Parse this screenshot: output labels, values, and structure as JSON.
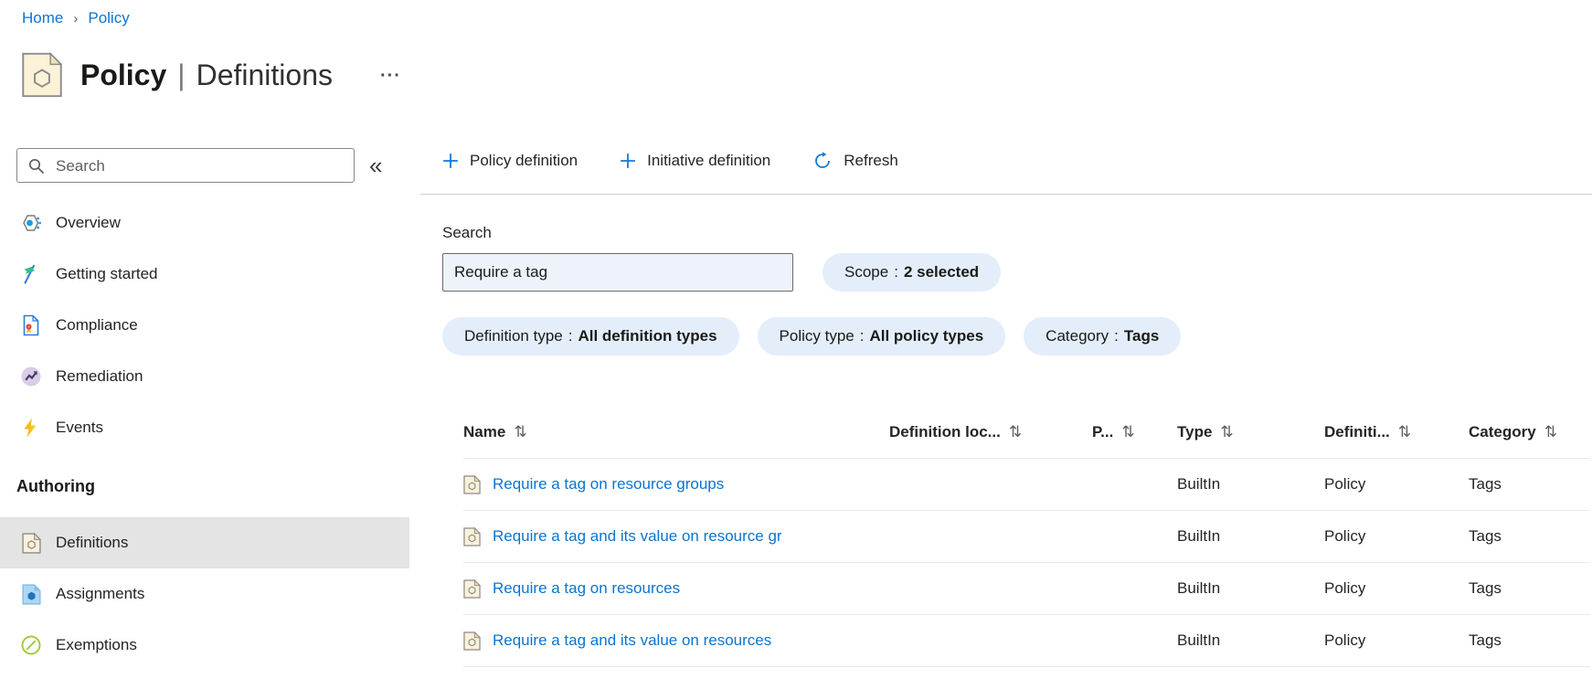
{
  "breadcrumb": {
    "separator": "›",
    "items": [
      {
        "label": "Home"
      },
      {
        "label": "Policy"
      }
    ]
  },
  "header": {
    "title_primary": "Policy",
    "title_separator": "|",
    "title_secondary": "Definitions",
    "more_glyph": "···"
  },
  "sidebar": {
    "search_placeholder": "Search",
    "collapse_glyph": "«",
    "items": [
      {
        "label": "Overview",
        "icon": "overview-icon"
      },
      {
        "label": "Getting started",
        "icon": "getting-started-icon"
      },
      {
        "label": "Compliance",
        "icon": "compliance-icon"
      },
      {
        "label": "Remediation",
        "icon": "remediation-icon"
      },
      {
        "label": "Events",
        "icon": "events-icon"
      }
    ],
    "section_label": "Authoring",
    "authoring_items": [
      {
        "label": "Definitions",
        "icon": "definitions-icon",
        "selected": true
      },
      {
        "label": "Assignments",
        "icon": "assignments-icon",
        "selected": false
      },
      {
        "label": "Exemptions",
        "icon": "exemptions-icon",
        "selected": false
      }
    ]
  },
  "toolbar": {
    "policy_definition_label": "Policy definition",
    "initiative_definition_label": "Initiative definition",
    "refresh_label": "Refresh"
  },
  "filters": {
    "search_label": "Search",
    "search_value": "Require a tag",
    "pill_separator": ":",
    "scope_pill": {
      "name": "Scope",
      "value": "2 selected"
    },
    "pills": [
      {
        "name": "Definition type",
        "value": "All definition types"
      },
      {
        "name": "Policy type",
        "value": "All policy types"
      },
      {
        "name": "Category",
        "value": "Tags"
      }
    ]
  },
  "table": {
    "sort_glyph": "⇅",
    "columns": [
      {
        "label": "Name"
      },
      {
        "label": "Definition loc..."
      },
      {
        "label": "P..."
      },
      {
        "label": "Type"
      },
      {
        "label": "Definiti..."
      },
      {
        "label": "Category"
      }
    ],
    "rows": [
      {
        "name": "Require a tag on resource groups",
        "definition_location": "",
        "policies": "",
        "type": "BuiltIn",
        "definition_type": "Policy",
        "category": "Tags"
      },
      {
        "name": "Require a tag and its value on resource gr",
        "definition_location": "",
        "policies": "",
        "type": "BuiltIn",
        "definition_type": "Policy",
        "category": "Tags"
      },
      {
        "name": "Require a tag on resources",
        "definition_location": "",
        "policies": "",
        "type": "BuiltIn",
        "definition_type": "Policy",
        "category": "Tags"
      },
      {
        "name": "Require a tag and its value on resources",
        "definition_location": "",
        "policies": "",
        "type": "BuiltIn",
        "definition_type": "Policy",
        "category": "Tags"
      }
    ]
  },
  "colors": {
    "accent_blue": "#0b74d1",
    "link_blue": "#0b74d1",
    "pill_background": "#e3eefa",
    "input_background": "#eef3fb",
    "selected_item_background": "#e4e4e4",
    "divider": "#d2d0ce",
    "row_separator": "#eaeaea",
    "policy_icon_fill": "#fbf2d7"
  }
}
